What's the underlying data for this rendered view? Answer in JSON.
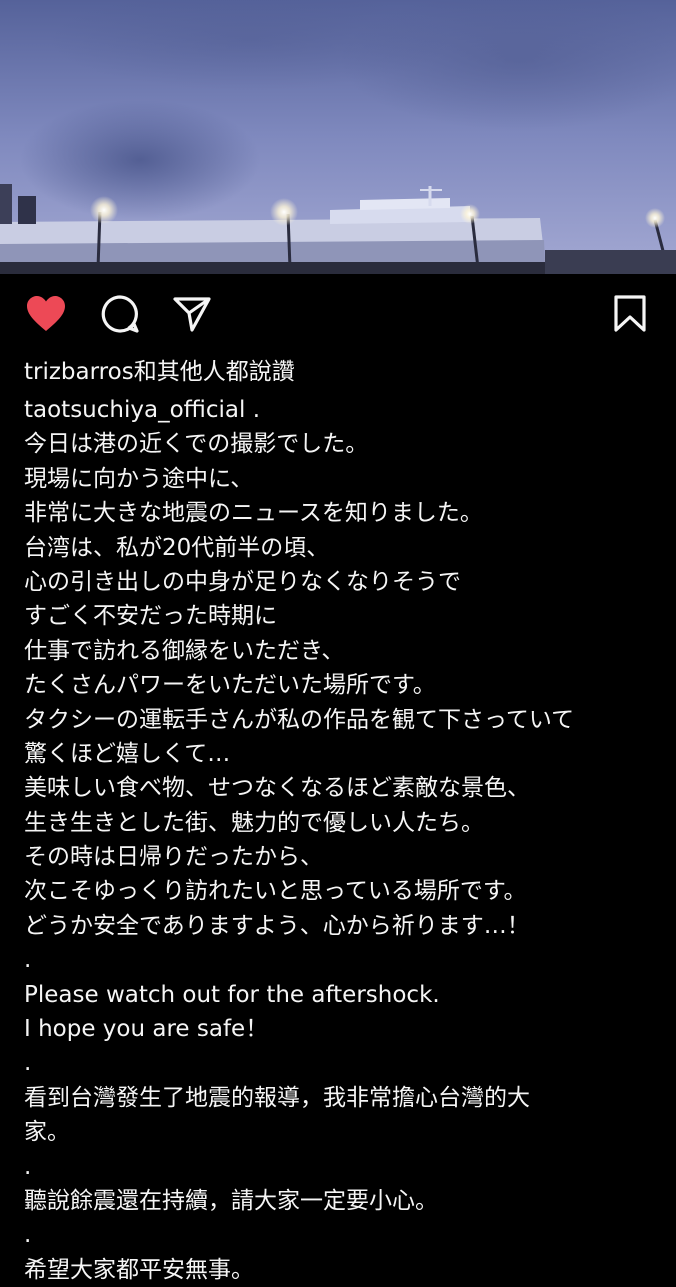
{
  "post": {
    "photo_alt": "Harbor with large ship under cloudy evening sky"
  },
  "actions": {
    "like": "heart-icon",
    "comment": "comment-icon",
    "share": "send-icon",
    "save": "bookmark-icon",
    "like_color": "#ed4956"
  },
  "likes_text": "trizbarros和其他人都說讚",
  "author": "taotsuchiya_official",
  "author_suffix": " .",
  "caption_lines": [
    "今日は港の近くでの撮影でした。",
    "現場に向かう途中に、",
    "非常に大きな地震のニュースを知りました。",
    "台湾は、私が20代前半の頃、",
    "心の引き出しの中身が足りなくなりそうで",
    "すごく不安だった時期に",
    "仕事で訪れる御縁をいただき、",
    "たくさんパワーをいただいた場所です。",
    "タクシーの運転手さんが私の作品を観て下さっていて",
    "驚くほど嬉しくて…",
    "美味しい食べ物、せつなくなるほど素敵な景色、",
    "生き生きとした街、魅力的で優しい人たち。",
    "その時は日帰りだったから、",
    "次こそゆっくり訪れたいと思っている場所です。",
    "どうか安全でありますよう、心から祈ります…！",
    ".",
    "Please watch out for the aftershock.",
    "I hope you are safe！",
    ".",
    "看到台灣發生了地震的報導，我非常擔心台灣的大",
    "家。",
    ".",
    "聽說餘震還在持續，請大家一定要小心。",
    ".",
    "希望大家都平安無事。"
  ]
}
